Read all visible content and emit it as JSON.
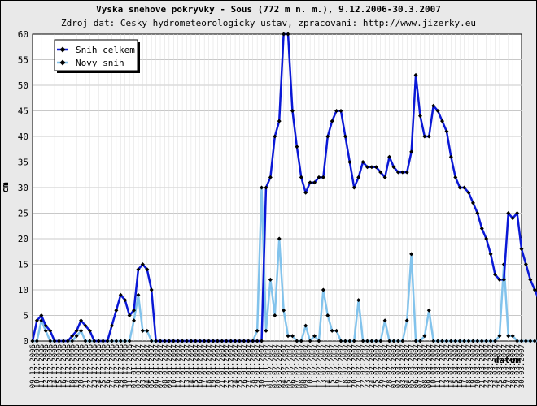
{
  "chart_data": {
    "type": "line",
    "title": "Vyska snehove pokryvky - Sous (772 m n. m.), 9.12.2006-30.3.2007",
    "subtitle": "Zdroj dat: Cesky hydrometeorologicky ustav, zpracovani: http://www.jizerky.eu",
    "xlabel": "datum",
    "ylabel": "cm",
    "ylim": [
      0,
      60
    ],
    "yticks": [
      0,
      5,
      10,
      15,
      20,
      25,
      30,
      35,
      40,
      45,
      50,
      55,
      60
    ],
    "grid": true,
    "legend_position": "top-left",
    "x": [
      "09.12.2006",
      "10.12.2006",
      "11.12.2006",
      "12.12.2006",
      "13.12.2006",
      "14.12.2006",
      "15.12.2006",
      "16.12.2006",
      "17.12.2006",
      "18.12.2006",
      "19.12.2006",
      "20.12.2006",
      "21.12.2006",
      "22.12.2006",
      "23.12.2006",
      "24.12.2006",
      "25.12.2006",
      "26.12.2006",
      "27.12.2006",
      "28.12.2006",
      "29.12.2006",
      "30.12.2006",
      "31.12.2006",
      "01.01.2007",
      "02.01.2007",
      "03.01.2007",
      "04.01.2007",
      "05.01.2007",
      "06.01.2007",
      "07.01.2007",
      "08.01.2007",
      "09.01.2007",
      "10.01.2007",
      "11.01.2007",
      "12.01.2007",
      "13.01.2007",
      "14.01.2007",
      "15.01.2007",
      "16.01.2007",
      "17.01.2007",
      "18.01.2007",
      "19.01.2007",
      "20.01.2007",
      "21.01.2007",
      "22.01.2007",
      "23.01.2007",
      "24.01.2007",
      "25.01.2007",
      "26.01.2007",
      "27.01.2007",
      "28.01.2007",
      "29.01.2007",
      "30.01.2007",
      "31.01.2007",
      "01.02.2007",
      "02.02.2007",
      "03.02.2007",
      "04.02.2007",
      "05.02.2007",
      "06.02.2007",
      "07.02.2007",
      "08.02.2007",
      "09.02.2007",
      "10.02.2007",
      "11.02.2007",
      "12.02.2007",
      "13.02.2007",
      "14.02.2007",
      "15.02.2007",
      "16.02.2007",
      "17.02.2007",
      "18.02.2007",
      "19.02.2007",
      "20.02.2007",
      "21.02.2007",
      "22.02.2007",
      "23.02.2007",
      "24.02.2007",
      "25.02.2007",
      "26.02.2007",
      "27.02.2007",
      "28.02.2007",
      "01.03.2007",
      "02.03.2007",
      "03.03.2007",
      "04.03.2007",
      "05.03.2007",
      "06.03.2007",
      "07.03.2007",
      "08.03.2007",
      "09.03.2007",
      "10.03.2007",
      "11.03.2007",
      "12.03.2007",
      "13.03.2007",
      "14.03.2007",
      "15.03.2007",
      "16.03.2007",
      "17.03.2007",
      "18.03.2007",
      "19.03.2007",
      "20.03.2007",
      "21.03.2007",
      "22.03.2007",
      "23.03.2007",
      "24.03.2007",
      "25.03.2007",
      "26.03.2007",
      "27.03.2007",
      "28.03.2007",
      "29.03.2007",
      "30.03.2007"
    ],
    "series": [
      {
        "name": "Snih celkem",
        "color": "#0a18d6",
        "values": [
          0,
          4,
          5,
          3,
          2,
          0,
          0,
          0,
          0,
          1,
          2,
          4,
          3,
          2,
          0,
          0,
          0,
          0,
          3,
          6,
          9,
          8,
          5,
          6,
          14,
          15,
          14,
          10,
          0,
          0,
          0,
          0,
          0,
          0,
          0,
          0,
          0,
          0,
          0,
          0,
          0,
          0,
          0,
          0,
          0,
          0,
          0,
          0,
          0,
          0,
          0,
          0,
          0,
          30,
          32,
          40,
          43,
          60,
          60,
          45,
          38,
          32,
          29,
          31,
          31,
          32,
          32,
          40,
          43,
          45,
          45,
          40,
          35,
          30,
          32,
          35,
          34,
          34,
          34,
          33,
          32,
          36,
          34,
          33,
          33,
          33,
          37,
          52,
          44,
          40,
          40,
          46,
          45,
          43,
          41,
          36,
          32,
          30,
          30,
          29,
          27,
          25,
          22,
          20,
          17,
          13,
          12,
          12,
          25,
          24,
          25,
          18,
          15,
          12,
          10,
          8,
          6,
          0
        ]
      },
      {
        "name": "Novy snih",
        "color": "#82c3ec",
        "values": [
          0,
          0,
          4,
          2,
          0,
          0,
          0,
          0,
          0,
          0,
          1,
          2,
          0,
          0,
          0,
          0,
          0,
          0,
          0,
          0,
          0,
          0,
          0,
          4,
          9,
          2,
          2,
          0,
          0,
          0,
          0,
          0,
          0,
          0,
          0,
          0,
          0,
          0,
          0,
          0,
          0,
          0,
          0,
          0,
          0,
          0,
          0,
          0,
          0,
          0,
          0,
          2,
          30,
          2,
          12,
          5,
          20,
          6,
          1,
          1,
          0,
          0,
          3,
          0,
          1,
          0,
          10,
          5,
          2,
          2,
          0,
          0,
          0,
          0,
          8,
          0,
          0,
          0,
          0,
          0,
          4,
          0,
          0,
          0,
          0,
          4,
          17,
          0,
          0,
          1,
          6,
          0,
          0,
          0,
          0,
          0,
          0,
          0,
          0,
          0,
          0,
          0,
          0,
          0,
          0,
          0,
          1,
          15,
          1,
          1,
          0,
          0,
          0,
          0,
          0,
          0
        ]
      }
    ]
  }
}
